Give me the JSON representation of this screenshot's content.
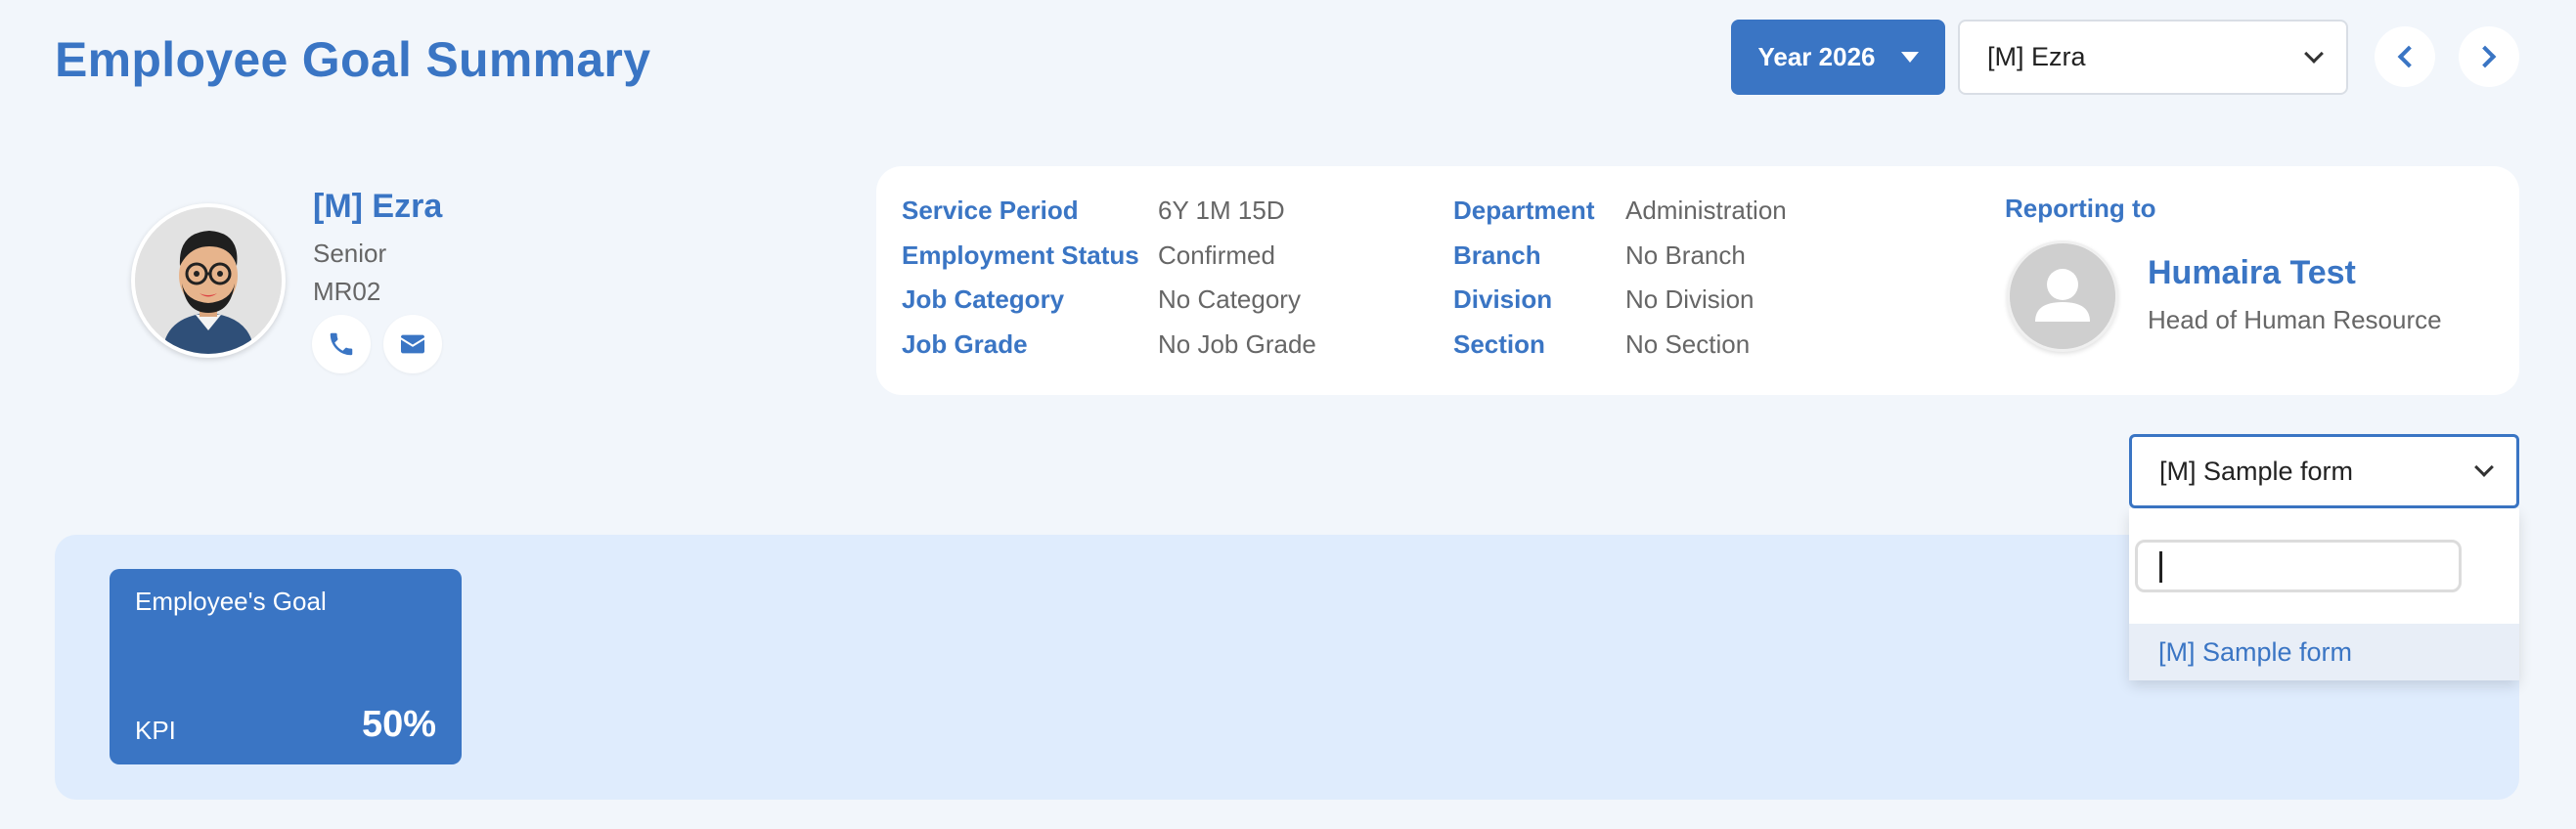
{
  "page": {
    "title": "Employee Goal Summary"
  },
  "controls": {
    "year_label": "Year 2026",
    "employee_select_value": "[M] Ezra"
  },
  "employee": {
    "name": "[M] Ezra",
    "level": "Senior",
    "code": "MR02"
  },
  "info": {
    "left": [
      {
        "label": "Service Period",
        "value": "6Y 1M 15D"
      },
      {
        "label": "Employment Status",
        "value": "Confirmed"
      },
      {
        "label": "Job Category",
        "value": "No Category"
      },
      {
        "label": "Job Grade",
        "value": "No Job Grade"
      }
    ],
    "right": [
      {
        "label": "Department",
        "value": "Administration"
      },
      {
        "label": "Branch",
        "value": "No Branch"
      },
      {
        "label": "Division",
        "value": "No Division"
      },
      {
        "label": "Section",
        "value": "No Section"
      }
    ]
  },
  "reporting": {
    "label": "Reporting to",
    "name": "Humaira Test",
    "title": "Head of Human Resource"
  },
  "form_select": {
    "value": "[M] Sample form",
    "search_value": "",
    "options": [
      "[M] Sample form"
    ]
  },
  "goal_card": {
    "title": "Employee's Goal",
    "kpi_label": "KPI",
    "percent": "50%"
  },
  "colors": {
    "accent": "#3a75c4",
    "background": "#f2f6fb",
    "panel": "#dfecfd"
  }
}
